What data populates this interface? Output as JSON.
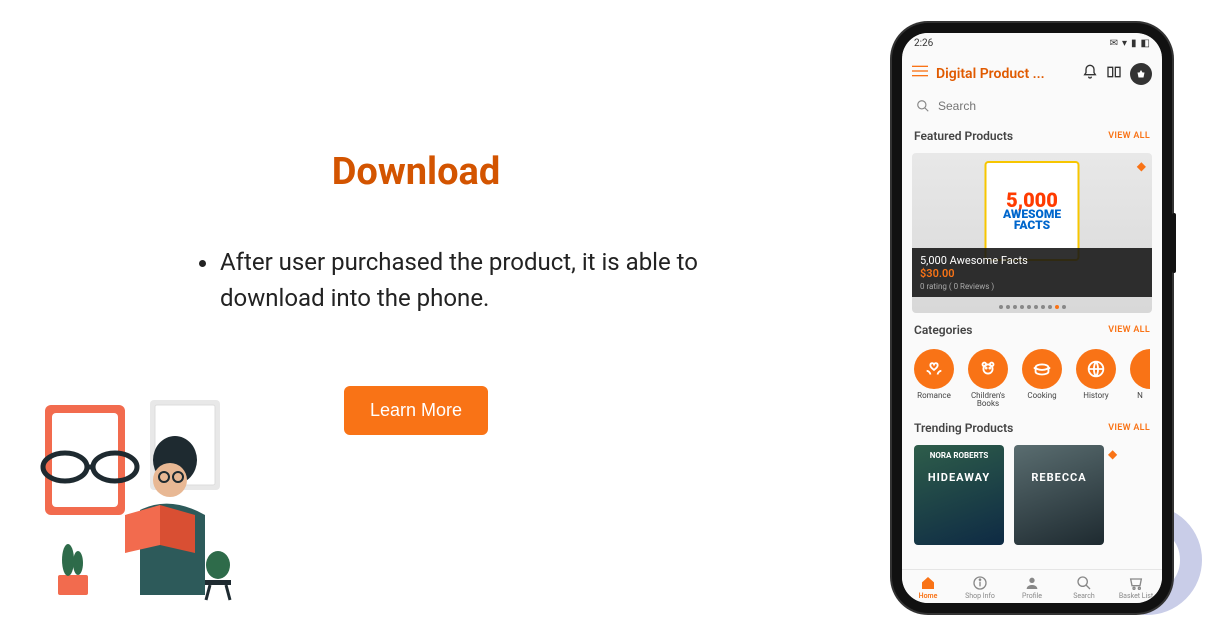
{
  "heading": "Download",
  "bullets": [
    "After user purchased the product, it is able to download into the phone."
  ],
  "learn_more": "Learn More",
  "phone": {
    "status_time": "2:26",
    "app_title": "Digital Product ...",
    "search_placeholder": "Search",
    "featured": {
      "heading": "Featured Products",
      "view_all": "VIEW ALL",
      "cover_big": "5,000",
      "cover_aw": "AWESOME",
      "cover_facts": "FACTS",
      "name": "5,000 Awesome Facts",
      "price": "$30.00",
      "rating": "0 rating ( 0 Reviews )"
    },
    "categories": {
      "heading": "Categories",
      "view_all": "VIEW ALL",
      "items": [
        {
          "label": "Romance"
        },
        {
          "label": "Children's Books"
        },
        {
          "label": "Cooking"
        },
        {
          "label": "History"
        },
        {
          "label": "N"
        }
      ]
    },
    "trending": {
      "heading": "Trending Products",
      "view_all": "VIEW ALL",
      "items": [
        {
          "author": "NORA ROBERTS",
          "title": "HIDEAWAY"
        },
        {
          "author": "",
          "title": "REBECCA"
        }
      ]
    },
    "nav": [
      {
        "label": "Home"
      },
      {
        "label": "Shop Info"
      },
      {
        "label": "Profile"
      },
      {
        "label": "Search"
      },
      {
        "label": "Basket List"
      }
    ]
  }
}
